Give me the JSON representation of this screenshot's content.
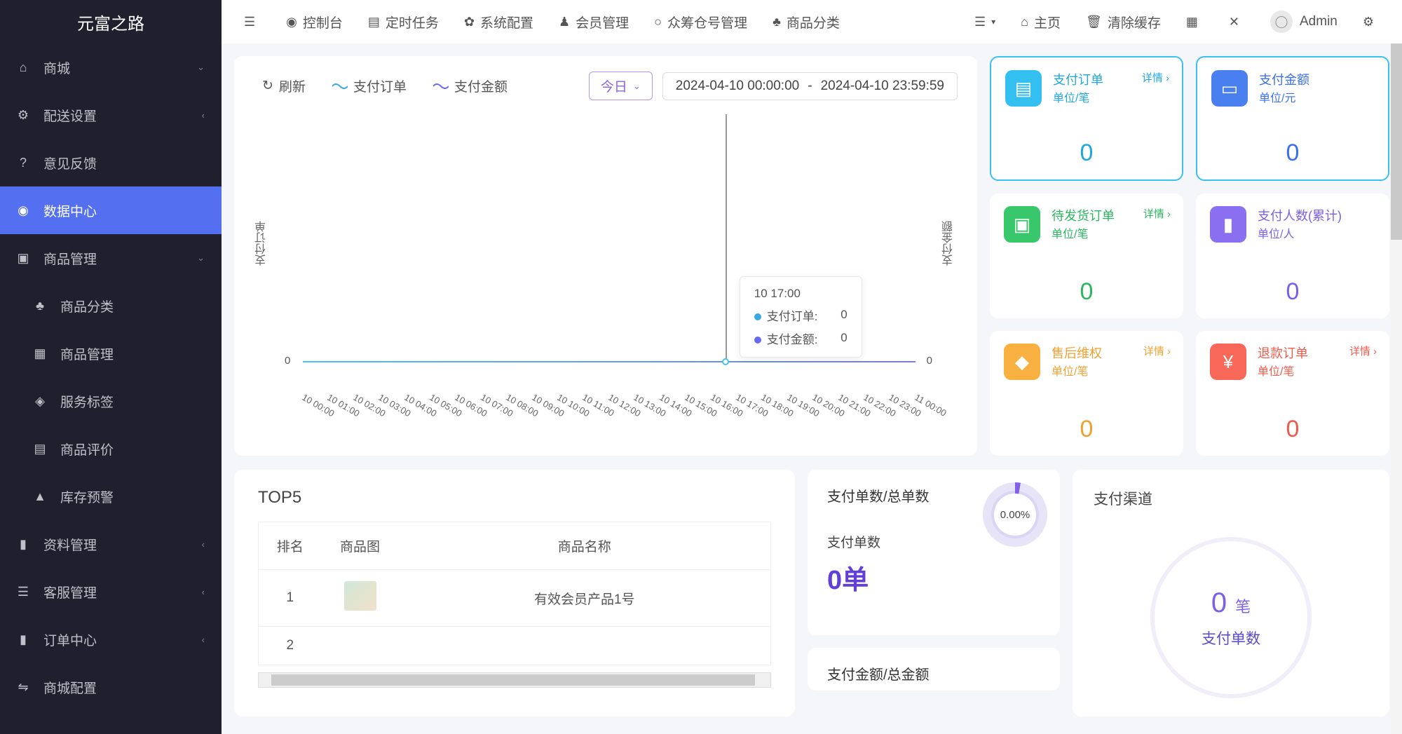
{
  "brand": "元富之路",
  "sidebar": {
    "mall": "商城",
    "delivery": "配送设置",
    "feedback": "意见反馈",
    "data_center": "数据中心",
    "product_manage": "商品管理",
    "product_cat": "商品分类",
    "product_admin": "商品管理",
    "service_tag": "服务标签",
    "product_review": "商品评价",
    "stock_alert": "库存预警",
    "material": "资料管理",
    "service_mgmt": "客服管理",
    "order_center": "订单中心",
    "mall_config": "商城配置"
  },
  "topbar": {
    "console": "控制台",
    "cron": "定时任务",
    "sys_config": "系统配置",
    "member": "会员管理",
    "warehouse": "众筹仓号管理",
    "category": "商品分类",
    "home": "主页",
    "clear_cache": "清除缓存",
    "admin": "Admin"
  },
  "chart": {
    "refresh": "刷新",
    "series1": "支付订单",
    "series2": "支付金额",
    "period": "今日",
    "range_start": "2024-04-10 00:00:00",
    "range_sep": "-",
    "range_end": "2024-04-10 23:59:59",
    "ylabel_left": "支付订单",
    "ylabel_right": "支付金额",
    "zero": "0",
    "tooltip": {
      "time": "10 17:00",
      "k1": "支付订单:",
      "v1": "0",
      "k2": "支付金额:",
      "v2": "0"
    }
  },
  "chart_data": {
    "type": "line",
    "categories": [
      "10 00:00",
      "10 01:00",
      "10 02:00",
      "10 03:00",
      "10 04:00",
      "10 05:00",
      "10 06:00",
      "10 07:00",
      "10 08:00",
      "10 09:00",
      "10 10:00",
      "10 11:00",
      "10 12:00",
      "10 13:00",
      "10 14:00",
      "10 15:00",
      "10 16:00",
      "10 17:00",
      "10 18:00",
      "10 19:00",
      "10 20:00",
      "10 21:00",
      "10 22:00",
      "10 23:00",
      "11 00:00"
    ],
    "series": [
      {
        "name": "支付订单",
        "values": [
          0,
          0,
          0,
          0,
          0,
          0,
          0,
          0,
          0,
          0,
          0,
          0,
          0,
          0,
          0,
          0,
          0,
          0,
          0,
          0,
          0,
          0,
          0,
          0,
          0
        ]
      },
      {
        "name": "支付金额",
        "values": [
          0,
          0,
          0,
          0,
          0,
          0,
          0,
          0,
          0,
          0,
          0,
          0,
          0,
          0,
          0,
          0,
          0,
          0,
          0,
          0,
          0,
          0,
          0,
          0,
          0
        ]
      }
    ],
    "ylim": [
      0,
      0
    ],
    "yaxes": [
      "支付订单",
      "支付金额"
    ]
  },
  "cards": {
    "detail": "详情 ›",
    "c0": {
      "title": "支付订单",
      "unit": "单位/笔",
      "val": "0"
    },
    "c1": {
      "title": "支付金额",
      "unit": "单位/元",
      "val": "0"
    },
    "c2": {
      "title": "待发货订单",
      "unit": "单位/笔",
      "val": "0"
    },
    "c3": {
      "title": "支付人数(累计)",
      "unit": "单位/人",
      "val": "0"
    },
    "c4": {
      "title": "售后维权",
      "unit": "单位/笔",
      "val": "0"
    },
    "c5": {
      "title": "退款订单",
      "unit": "单位/笔",
      "val": "0"
    }
  },
  "top5": {
    "title": "TOP5",
    "col_rank": "排名",
    "col_img": "商品图",
    "col_name": "商品名称",
    "rows": {
      "r0": {
        "rank": "1",
        "name": "有效会员产品1号"
      },
      "r1": {
        "rank": "2"
      }
    }
  },
  "gauge": {
    "g0": {
      "title": "支付单数/总单数",
      "sub": "支付单数",
      "val": "0单",
      "pct": "0.00%"
    },
    "g1": {
      "title": "支付金额/总金额"
    }
  },
  "channel": {
    "title": "支付渠道",
    "num": "0",
    "unit": "笔",
    "label": "支付单数"
  }
}
